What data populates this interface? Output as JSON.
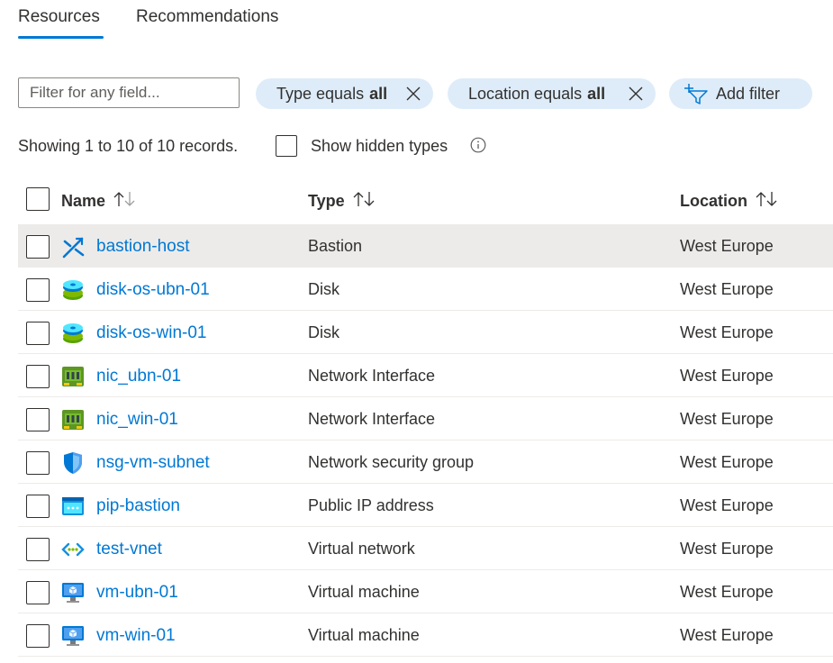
{
  "tabs": [
    {
      "label": "Resources",
      "active": true
    },
    {
      "label": "Recommendations",
      "active": false
    }
  ],
  "filter": {
    "placeholder": "Filter for any field...",
    "value": "",
    "pills": [
      {
        "prefix": "Type equals",
        "value": "all"
      },
      {
        "prefix": "Location equals",
        "value": "all"
      }
    ],
    "add_filter_label": "Add filter"
  },
  "summary": "Showing 1 to 10 of 10 records.",
  "show_hidden_label": "Show hidden types",
  "columns": {
    "name": "Name",
    "type": "Type",
    "location": "Location"
  },
  "rows": [
    {
      "name": "bastion-host",
      "type": "Bastion",
      "location": "West Europe",
      "icon": "bastion-icon",
      "selected": true
    },
    {
      "name": "disk-os-ubn-01",
      "type": "Disk",
      "location": "West Europe",
      "icon": "disk-icon",
      "selected": false
    },
    {
      "name": "disk-os-win-01",
      "type": "Disk",
      "location": "West Europe",
      "icon": "disk-icon",
      "selected": false
    },
    {
      "name": "nic_ubn-01",
      "type": "Network Interface",
      "location": "West Europe",
      "icon": "network-interface-icon",
      "selected": false
    },
    {
      "name": "nic_win-01",
      "type": "Network Interface",
      "location": "West Europe",
      "icon": "network-interface-icon",
      "selected": false
    },
    {
      "name": "nsg-vm-subnet",
      "type": "Network security group",
      "location": "West Europe",
      "icon": "shield-icon",
      "selected": false
    },
    {
      "name": "pip-bastion",
      "type": "Public IP address",
      "location": "West Europe",
      "icon": "public-ip-icon",
      "selected": false
    },
    {
      "name": "test-vnet",
      "type": "Virtual network",
      "location": "West Europe",
      "icon": "virtual-network-icon",
      "selected": false
    },
    {
      "name": "vm-ubn-01",
      "type": "Virtual machine",
      "location": "West Europe",
      "icon": "virtual-machine-icon",
      "selected": false
    },
    {
      "name": "vm-win-01",
      "type": "Virtual machine",
      "location": "West Europe",
      "icon": "virtual-machine-icon",
      "selected": false
    }
  ],
  "colors": {
    "accent": "#0078d4",
    "pill_bg": "#deecf9",
    "selected_row": "#edebe9"
  }
}
